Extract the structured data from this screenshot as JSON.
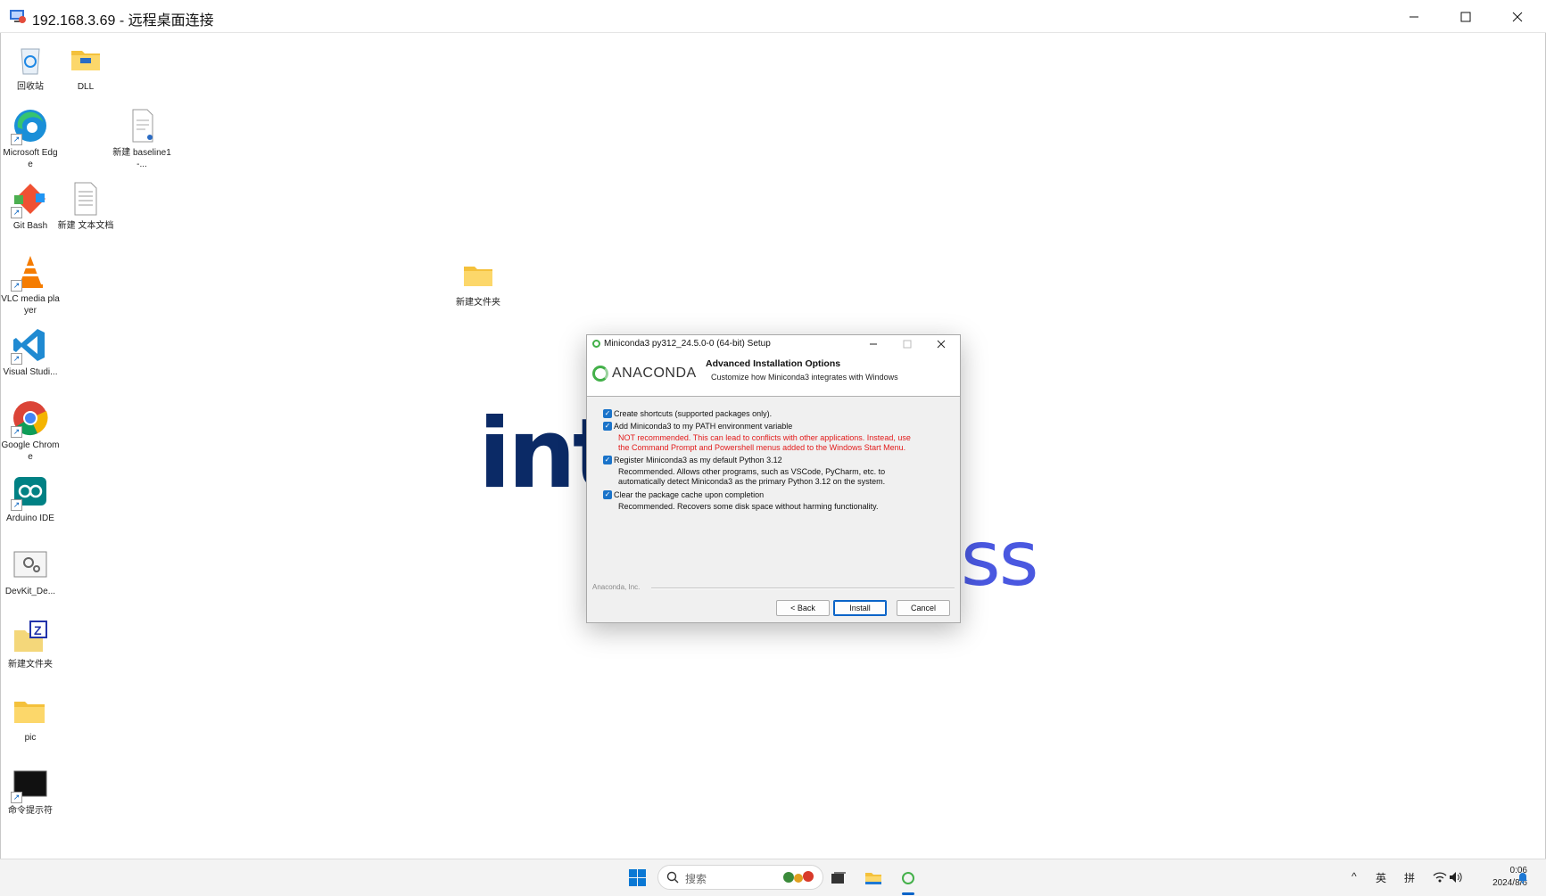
{
  "rdp": {
    "title": "192.168.3.69 - 远程桌面连接",
    "controls": {
      "minimize": "—",
      "maximize": "☐",
      "close": "✕"
    }
  },
  "desktop": {
    "icons": [
      {
        "label": "回收站",
        "icon": "recycle-bin-icon"
      },
      {
        "label": "DLL",
        "icon": "folder-icon"
      },
      {
        "label": "Microsoft Edge",
        "icon": "edge-icon"
      },
      {
        "label": "新建 baseline1-...",
        "icon": "document-icon"
      },
      {
        "label": "Git Bash",
        "icon": "git-icon"
      },
      {
        "label": "新建 文本文档",
        "icon": "text-file-icon"
      },
      {
        "label": "新建文件夹",
        "icon": "folder-icon"
      },
      {
        "label": "VLC media player",
        "icon": "vlc-icon"
      },
      {
        "label": "Visual Studi...",
        "icon": "vscode-icon"
      },
      {
        "label": "Google Chrome",
        "icon": "chrome-icon"
      },
      {
        "label": "Arduino IDE",
        "icon": "arduino-icon"
      },
      {
        "label": "DevKit_De...",
        "icon": "settings-app-icon"
      },
      {
        "label": "新建文件夹",
        "icon": "zip-folder-icon"
      },
      {
        "label": "pic",
        "icon": "folder-icon"
      },
      {
        "label": "命令提示符",
        "icon": "terminal-icon"
      }
    ],
    "wallpaper_text": {
      "left": "inte",
      "right": "ess"
    }
  },
  "installer": {
    "title": "Miniconda3 py312_24.5.0-0 (64-bit) Setup",
    "logo_text": "ANACONDA",
    "header_title": "Advanced Installation Options",
    "header_subtitle": "Customize how Miniconda3 integrates with Windows",
    "options": [
      {
        "label": "Create shortcuts (supported packages only).",
        "checked": true,
        "description": ""
      },
      {
        "label": "Add Miniconda3 to my PATH environment variable",
        "checked": true,
        "description_line1": "NOT recommended. This can lead to conflicts with other applications. Instead, use",
        "description_line2": "the Command Prompt and Powershell menus added to the Windows Start Menu."
      },
      {
        "label": "Register Miniconda3 as my default Python 3.12",
        "checked": true,
        "description_line1": "Recommended. Allows other programs, such as VSCode, PyCharm, etc. to",
        "description_line2": "automatically detect Miniconda3 as the primary Python 3.12 on the system."
      },
      {
        "label": "Clear the package cache upon completion",
        "checked": true,
        "description_line1": "Recommended. Recovers some disk space without harming functionality."
      }
    ],
    "footer_brand": "Anaconda, Inc.",
    "buttons": {
      "back": "< Back",
      "install": "Install",
      "cancel": "Cancel"
    },
    "checkmark": "✓"
  },
  "taskbar": {
    "search_placeholder": "搜索",
    "tray": {
      "chevron": "^",
      "ime_lang": "英",
      "ime_mode": "拼"
    },
    "clock": {
      "time": "0:06",
      "date": "2024/8/6"
    }
  },
  "colors": {
    "accent": "#0a64c8",
    "anaconda_green": "#43b049",
    "warning_red": "#e21b1b"
  }
}
